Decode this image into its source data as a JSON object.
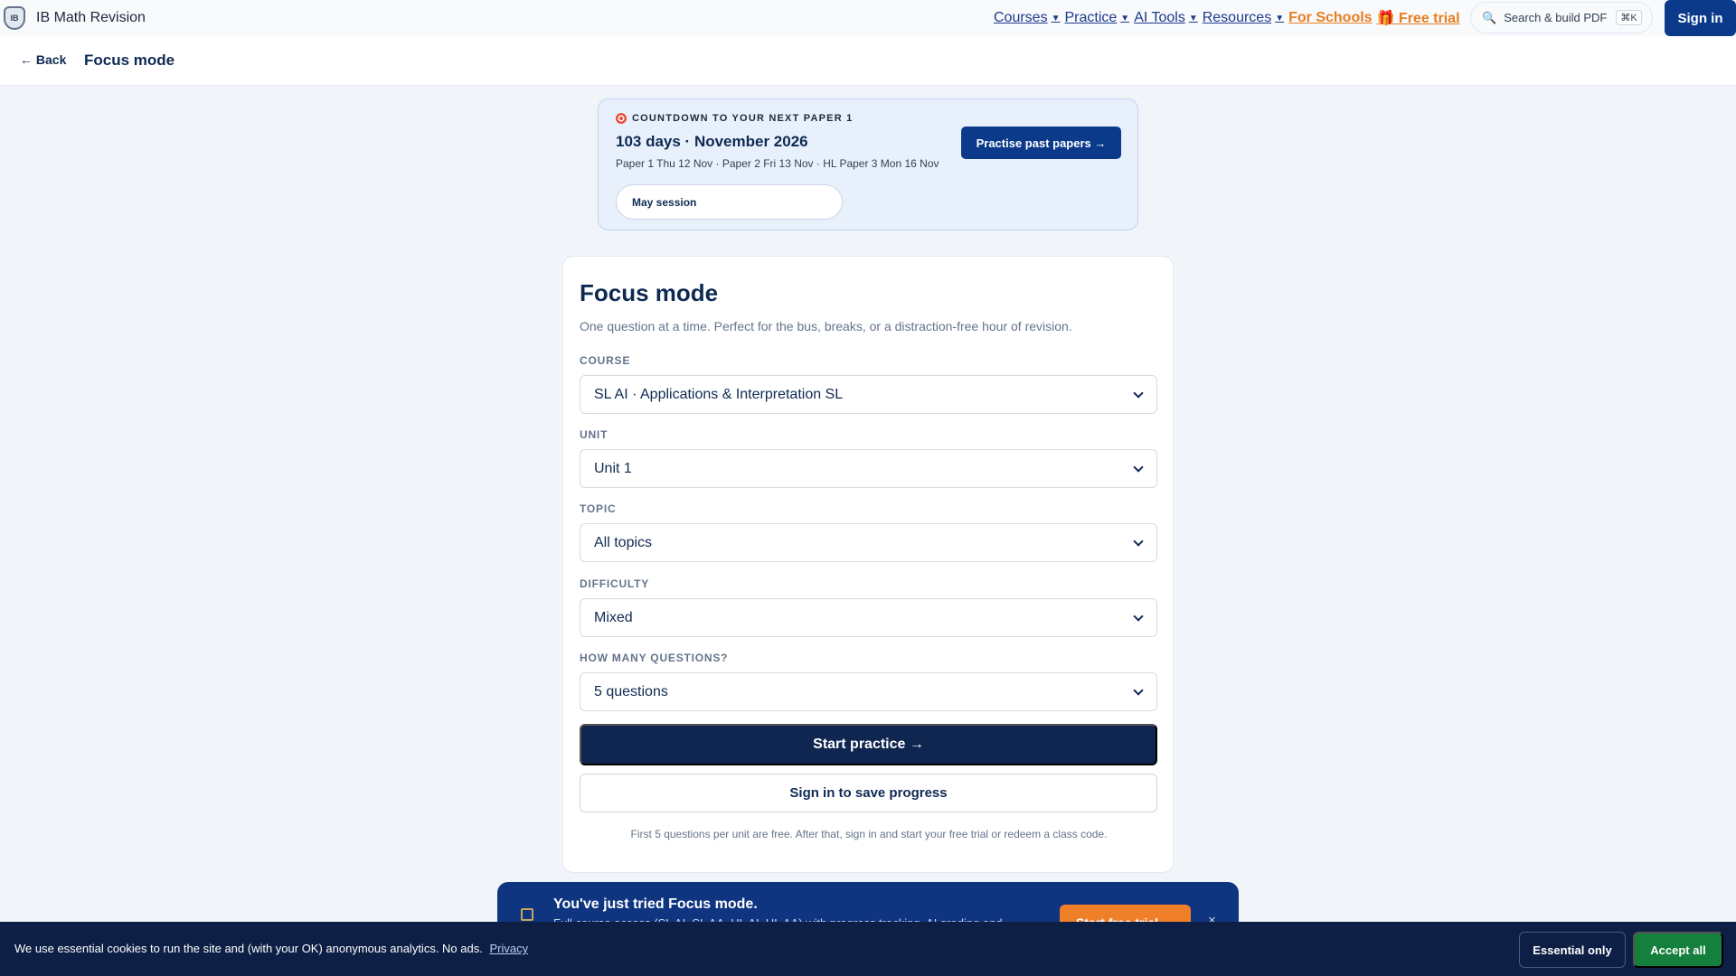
{
  "brand": {
    "name": "IB Math Revision",
    "logo_text": "IB"
  },
  "nav": {
    "items": [
      {
        "label": "Courses",
        "caret": "▼"
      },
      {
        "label": "Practice",
        "caret": "▼"
      },
      {
        "label": "AI Tools",
        "caret": "▼"
      },
      {
        "label": "Resources",
        "caret": "▼"
      }
    ],
    "for_schools": "For Schools",
    "free_trial": "🎁 Free trial",
    "search_placeholder": "Search & build PDF",
    "search_shortcut": "⌘K",
    "sign_in": "Sign in"
  },
  "subheader": {
    "back": "← Back",
    "title": "Focus mode"
  },
  "countdown": {
    "label": "COUNTDOWN TO YOUR NEXT PAPER 1",
    "days": "103 days · November 2026",
    "schedule": "Paper 1 Thu 12 Nov · Paper 2 Fri 13 Nov · HL Paper 3 Mon 16 Nov",
    "session": "May session",
    "cta": "Practise past papers →"
  },
  "form": {
    "title": "Focus mode",
    "subtitle": "One question at a time. Perfect for the bus, breaks, or a distraction-free hour of revision.",
    "course": {
      "label": "COURSE",
      "value": "SL AI · Applications & Interpretation SL"
    },
    "unit": {
      "label": "UNIT",
      "value": "Unit 1"
    },
    "topic": {
      "label": "TOPIC",
      "value": "All topics"
    },
    "difficulty": {
      "label": "DIFFICULTY",
      "value": "Mixed"
    },
    "count": {
      "label": "HOW MANY QUESTIONS?",
      "value": "5 questions"
    },
    "start": "Start practice →",
    "save": "Sign in to save progress",
    "note": "First 5 questions per unit are free. After that, sign in and start your free trial or redeem a class code."
  },
  "upsell": {
    "title": "You've just tried Focus mode.",
    "description": "Full course access (SL AI, SL AA, HL AI, HL AA) with progress tracking, AI grading and",
    "cta": "Start free trial →",
    "close": "×"
  },
  "cookie": {
    "text": "We use essential cookies to run the site and (with your OK) anonymous analytics. No ads.",
    "privacy": "Privacy",
    "essential": "Essential only",
    "accept": "Accept all"
  }
}
